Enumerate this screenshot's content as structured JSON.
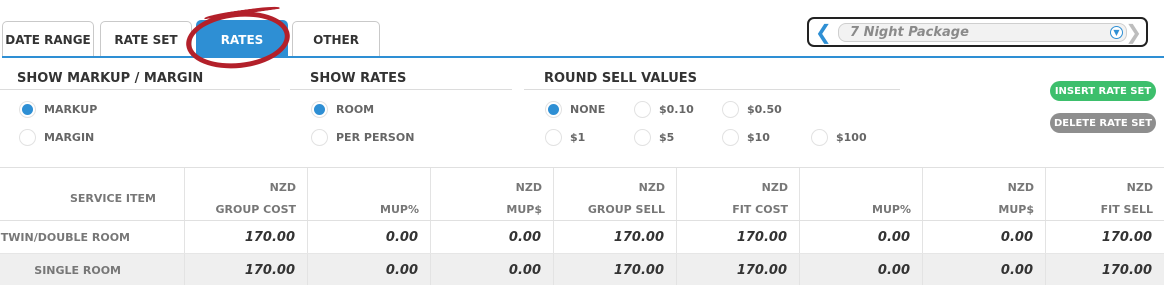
{
  "tabs": [
    {
      "label": "DATE RANGE",
      "active": false
    },
    {
      "label": "RATE SET",
      "active": false
    },
    {
      "label": "RATES",
      "active": true
    },
    {
      "label": "OTHER",
      "active": false
    }
  ],
  "package_select": {
    "value": "7 Night Package"
  },
  "groups": {
    "markup": {
      "title": "SHOW MARKUP / MARGIN",
      "options": [
        {
          "label": "MARKUP",
          "selected": true
        },
        {
          "label": "MARGIN",
          "selected": false
        }
      ]
    },
    "rates": {
      "title": "SHOW RATES",
      "options": [
        {
          "label": "ROOM",
          "selected": true
        },
        {
          "label": "PER PERSON",
          "selected": false
        }
      ]
    },
    "round": {
      "title": "ROUND SELL VALUES",
      "options": [
        {
          "label": "NONE",
          "selected": true
        },
        {
          "label": "$0.10",
          "selected": false
        },
        {
          "label": "$0.50",
          "selected": false
        },
        {
          "label": "$1",
          "selected": false
        },
        {
          "label": "$5",
          "selected": false
        },
        {
          "label": "$10",
          "selected": false
        },
        {
          "label": "$100",
          "selected": false
        }
      ]
    }
  },
  "buttons": {
    "insert": "INSERT RATE SET",
    "delete": "DELETE RATE SET"
  },
  "table": {
    "item_header": "SERVICE ITEM",
    "columns": [
      {
        "currency": "NZD",
        "label": "GROUP COST"
      },
      {
        "currency": "",
        "label": "MUP%"
      },
      {
        "currency": "NZD",
        "label": "MUP$"
      },
      {
        "currency": "NZD",
        "label": "GROUP SELL"
      },
      {
        "currency": "NZD",
        "label": "FIT COST"
      },
      {
        "currency": "",
        "label": "MUP%"
      },
      {
        "currency": "NZD",
        "label": "MUP$"
      },
      {
        "currency": "NZD",
        "label": "FIT SELL"
      }
    ],
    "rows": [
      {
        "name": "TWIN/DOUBLE ROOM",
        "values": [
          "170.00",
          "0.00",
          "0.00",
          "170.00",
          "170.00",
          "0.00",
          "0.00",
          "170.00"
        ]
      },
      {
        "name": "SINGLE ROOM",
        "values": [
          "170.00",
          "0.00",
          "0.00",
          "170.00",
          "170.00",
          "0.00",
          "0.00",
          "170.00"
        ]
      }
    ]
  },
  "colors": {
    "accent": "#2e8fd4",
    "insert_button": "#3dbf6c",
    "delete_button": "#8e8e8e",
    "annotation": "#b3202a"
  }
}
